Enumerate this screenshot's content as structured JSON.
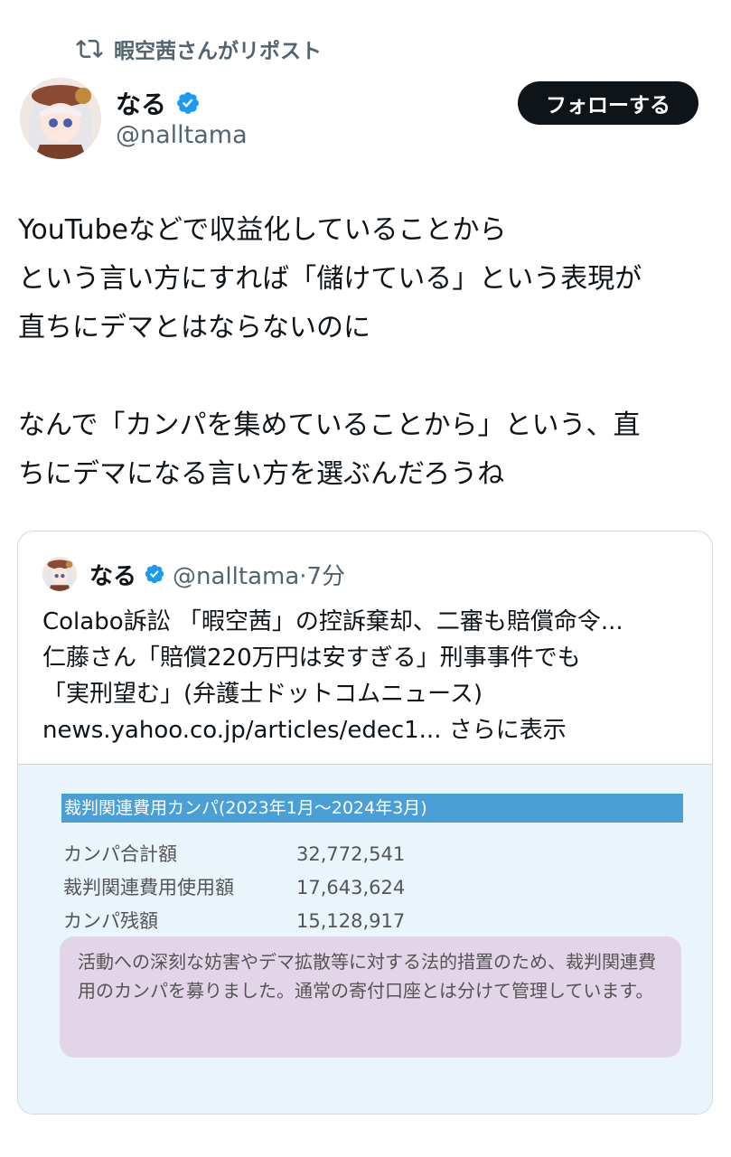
{
  "repost": {
    "label": "暇空茜さんがリポスト",
    "icon": "repost-icon"
  },
  "author": {
    "name": "なる",
    "handle": "@nalltama",
    "verified": true
  },
  "follow_button": {
    "label": "フォローする"
  },
  "tweet": {
    "text": "YouTubeなどで収益化していることから\nという言い方にすれば「儲けている」という表現が\n直ちにデマとはならないのに\n\nなんで「カンパを集めていることから」という、直\nちにデマになる言い方を選ぶんだろうね"
  },
  "quote": {
    "name": "なる",
    "handle": "@nalltama",
    "time": "7分",
    "lines": [
      "Colabo訴訟 「暇空茜」の控訴棄却、二審も賠償命令...",
      "仁藤さん「賠償220万円は安すぎる」刑事事件でも",
      "「実刑望む」(弁護士ドットコムニュース)"
    ],
    "link": "news.yahoo.co.jp/articles/edec1...",
    "show_more": "さらに表示",
    "image": {
      "header": "裁判関連費用カンパ(2023年1月〜2024年3月)",
      "rows": [
        {
          "label": "カンパ合計額",
          "value": "32,772,541"
        },
        {
          "label": "裁判関連費用使用額",
          "value": "17,643,624"
        },
        {
          "label": "カンパ残額",
          "value": "15,128,917"
        }
      ],
      "note": "活動への深刻な妨害やデマ拡散等に対する法的措置のため、裁判関連費用のカンパを募りました。通常の寄付口座とは分けて管理しています。"
    }
  },
  "colors": {
    "accent": "#1d9bf0",
    "button_bg": "#0f1419",
    "muted": "#536471",
    "image_header": "#4a9fd7",
    "image_note_bg": "#e2d5e7"
  }
}
